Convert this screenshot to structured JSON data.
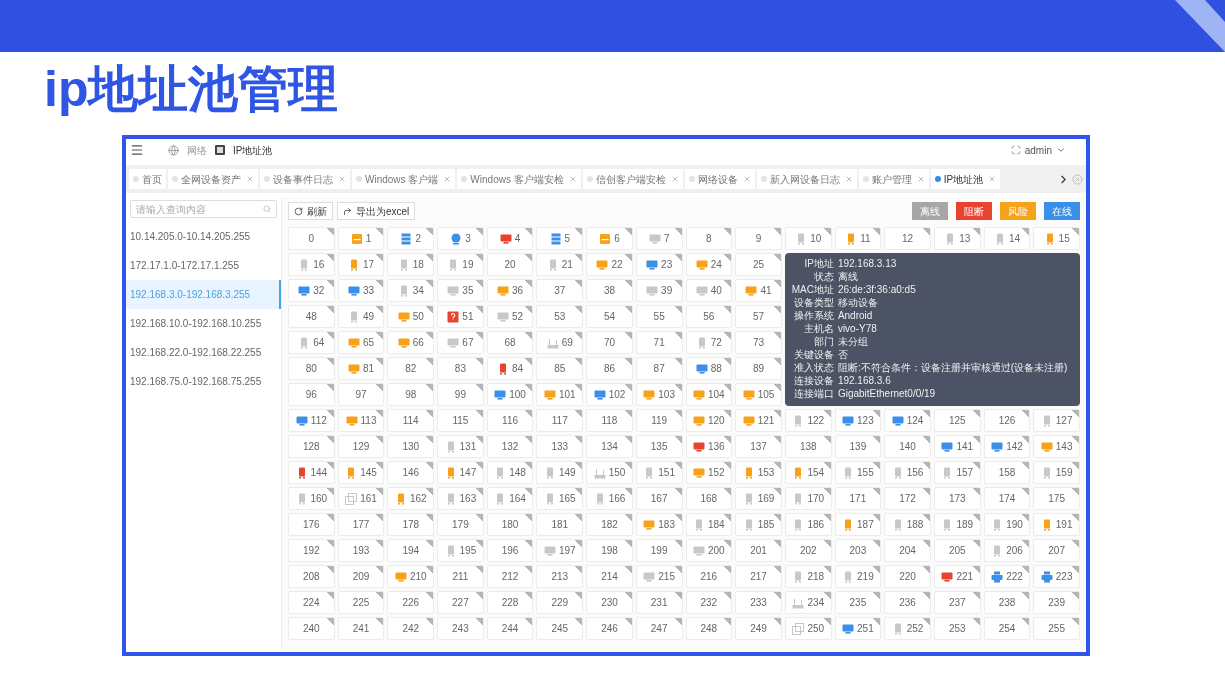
{
  "slide_title": "ip地址池管理",
  "header": {
    "breadcrumb": [
      "网络",
      "IP地址池"
    ],
    "user": "admin"
  },
  "tabs": [
    {
      "label": "首页",
      "selected": false,
      "closable": false
    },
    {
      "label": "全网设备资产",
      "selected": false,
      "closable": true
    },
    {
      "label": "设备事件日志",
      "selected": false,
      "closable": true
    },
    {
      "label": "Windows 客户端",
      "selected": false,
      "closable": true
    },
    {
      "label": "Windows 客户端安检",
      "selected": false,
      "closable": true
    },
    {
      "label": "信创客户端安检",
      "selected": false,
      "closable": true
    },
    {
      "label": "网络设备",
      "selected": false,
      "closable": true
    },
    {
      "label": "新入网设备日志",
      "selected": false,
      "closable": true
    },
    {
      "label": "账户管理",
      "selected": false,
      "closable": true
    },
    {
      "label": "IP地址池",
      "selected": true,
      "closable": true
    }
  ],
  "sidebar": {
    "search": {
      "placeholder": "请输入查询内容"
    },
    "items": [
      {
        "label": "10.14.205.0-10.14.205.255",
        "selected": false
      },
      {
        "label": "172.17.1.0-172.17.1.255",
        "selected": false
      },
      {
        "label": "192.168.3.0-192.168.3.255",
        "selected": true
      },
      {
        "label": "192.168.10.0-192.168.10.255",
        "selected": false
      },
      {
        "label": "192.168.22.0-192.168.22.255",
        "selected": false
      },
      {
        "label": "192.168.75.0-192.168.75.255",
        "selected": false
      }
    ]
  },
  "toolbar": {
    "buttons": [
      {
        "kind": "refresh",
        "label": "刷新"
      },
      {
        "kind": "export",
        "label": "导出为excel"
      }
    ],
    "legend": [
      {
        "label": "离线",
        "color": "#a6a6a6"
      },
      {
        "label": "阻断",
        "color": "#e8432f"
      },
      {
        "label": "风险",
        "color": "#f7a21b"
      },
      {
        "label": "在线",
        "color": "#3b8fe8"
      }
    ]
  },
  "grid": {
    "cells": [
      {
        "label": "0"
      },
      {
        "label": "1",
        "kind": "laptop",
        "color": "#f7a21b"
      },
      {
        "label": "2",
        "kind": "server",
        "color": "#3b8fe8"
      },
      {
        "label": "3",
        "kind": "camera",
        "color": "#3b8fe8"
      },
      {
        "label": "4",
        "kind": "monitor",
        "color": "#e8432f"
      },
      {
        "label": "5",
        "kind": "server",
        "color": "#3b8fe8"
      },
      {
        "label": "6",
        "kind": "laptop",
        "color": "#f7a21b"
      },
      {
        "label": "7",
        "kind": "monitor",
        "color": "#c8c8c8"
      },
      {
        "label": "8"
      },
      {
        "label": "9"
      },
      {
        "label": "10",
        "kind": "phone",
        "color": "#c8c8c8"
      },
      {
        "label": "11",
        "kind": "phone",
        "color": "#f7a21b"
      },
      {
        "label": "12"
      },
      {
        "label": "13",
        "kind": "phone",
        "color": "#c8c8c8"
      },
      {
        "label": "14",
        "kind": "phone",
        "color": "#c8c8c8"
      },
      {
        "label": "15",
        "kind": "phone",
        "color": "#f7a21b"
      },
      {
        "label": "16",
        "kind": "phone",
        "color": "#c8c8c8"
      },
      {
        "label": "17",
        "kind": "phone",
        "color": "#f7a21b"
      },
      {
        "label": "18",
        "kind": "phone",
        "color": "#c8c8c8"
      },
      {
        "label": "19",
        "kind": "phone",
        "color": "#c8c8c8"
      },
      {
        "label": "20"
      },
      {
        "label": "21",
        "kind": "phone",
        "color": "#c8c8c8"
      },
      {
        "label": "22",
        "kind": "monitor",
        "color": "#f7a21b"
      },
      {
        "label": "23",
        "kind": "monitor",
        "color": "#3b8fe8"
      },
      {
        "label": "24",
        "kind": "monitor",
        "color": "#f7a21b"
      },
      {
        "label": "25"
      },
      {
        "label": "32",
        "kind": "monitor",
        "color": "#3b8fe8"
      },
      {
        "label": "33",
        "kind": "monitor",
        "color": "#3b8fe8"
      },
      {
        "label": "34",
        "kind": "phone",
        "color": "#c8c8c8"
      },
      {
        "label": "35",
        "kind": "monitor",
        "color": "#c8c8c8"
      },
      {
        "label": "36",
        "kind": "monitor",
        "color": "#f7a21b"
      },
      {
        "label": "37"
      },
      {
        "label": "38"
      },
      {
        "label": "39",
        "kind": "monitor",
        "color": "#c8c8c8"
      },
      {
        "label": "40",
        "kind": "monitor",
        "color": "#c8c8c8"
      },
      {
        "label": "41",
        "kind": "monitor",
        "color": "#f7a21b"
      },
      {
        "label": "48"
      },
      {
        "label": "49",
        "kind": "phone",
        "color": "#c8c8c8"
      },
      {
        "label": "50",
        "kind": "monitor",
        "color": "#f7a21b"
      },
      {
        "label": "51",
        "kind": "question",
        "color": "#e8432f"
      },
      {
        "label": "52",
        "kind": "monitor",
        "color": "#c8c8c8"
      },
      {
        "label": "53"
      },
      {
        "label": "54"
      },
      {
        "label": "55"
      },
      {
        "label": "56"
      },
      {
        "label": "57"
      },
      {
        "label": "64",
        "kind": "phone",
        "color": "#c8c8c8"
      },
      {
        "label": "65",
        "kind": "monitor",
        "color": "#f7a21b"
      },
      {
        "label": "66",
        "kind": "monitor",
        "color": "#f7a21b"
      },
      {
        "label": "67",
        "kind": "monitor",
        "color": "#c8c8c8"
      },
      {
        "label": "68"
      },
      {
        "label": "69",
        "kind": "router",
        "color": "#c8c8c8"
      },
      {
        "label": "70"
      },
      {
        "label": "71"
      },
      {
        "label": "72",
        "kind": "phone",
        "color": "#c8c8c8"
      },
      {
        "label": "73"
      },
      {
        "label": "80"
      },
      {
        "label": "81",
        "kind": "monitor",
        "color": "#f7a21b"
      },
      {
        "label": "82"
      },
      {
        "label": "83"
      },
      {
        "label": "84",
        "kind": "phone",
        "color": "#e8432f"
      },
      {
        "label": "85"
      },
      {
        "label": "86"
      },
      {
        "label": "87"
      },
      {
        "label": "88",
        "kind": "monitor",
        "color": "#3b8fe8"
      },
      {
        "label": "89"
      },
      {
        "label": "96"
      },
      {
        "label": "97"
      },
      {
        "label": "98"
      },
      {
        "label": "99"
      },
      {
        "label": "100",
        "kind": "monitor",
        "color": "#3b8fe8"
      },
      {
        "label": "101",
        "kind": "monitor",
        "color": "#f7a21b"
      },
      {
        "label": "102",
        "kind": "monitor",
        "color": "#3b8fe8"
      },
      {
        "label": "103",
        "kind": "monitor",
        "color": "#f7a21b"
      },
      {
        "label": "104",
        "kind": "monitor",
        "color": "#f7a21b"
      },
      {
        "label": "105",
        "kind": "monitor",
        "color": "#f7a21b"
      },
      {
        "label": "112",
        "kind": "monitor",
        "color": "#3b8fe8"
      },
      {
        "label": "113",
        "kind": "monitor",
        "color": "#f7a21b"
      },
      {
        "label": "114"
      },
      {
        "label": "115"
      },
      {
        "label": "116"
      },
      {
        "label": "117"
      },
      {
        "label": "118"
      },
      {
        "label": "119"
      },
      {
        "label": "120",
        "kind": "monitor",
        "color": "#f7a21b"
      },
      {
        "label": "121",
        "kind": "monitor",
        "color": "#f7a21b"
      },
      {
        "label": "122",
        "kind": "phone",
        "color": "#c8c8c8"
      },
      {
        "label": "123",
        "kind": "monitor",
        "color": "#3b8fe8"
      },
      {
        "label": "124",
        "kind": "monitor",
        "color": "#3b8fe8"
      },
      {
        "label": "125"
      },
      {
        "label": "126"
      },
      {
        "label": "127",
        "kind": "phone",
        "color": "#c8c8c8"
      },
      {
        "label": "128"
      },
      {
        "label": "129"
      },
      {
        "label": "130"
      },
      {
        "label": "131",
        "kind": "phone",
        "color": "#c8c8c8"
      },
      {
        "label": "132"
      },
      {
        "label": "133"
      },
      {
        "label": "134"
      },
      {
        "label": "135"
      },
      {
        "label": "136",
        "kind": "monitor",
        "color": "#e8432f"
      },
      {
        "label": "137"
      },
      {
        "label": "138"
      },
      {
        "label": "139"
      },
      {
        "label": "140"
      },
      {
        "label": "141",
        "kind": "monitor",
        "color": "#3b8fe8"
      },
      {
        "label": "142",
        "kind": "monitor",
        "color": "#3b8fe8"
      },
      {
        "label": "143",
        "kind": "monitor",
        "color": "#f7a21b"
      },
      {
        "label": "144",
        "kind": "phone",
        "color": "#e8432f"
      },
      {
        "label": "145",
        "kind": "phone",
        "color": "#f7a21b"
      },
      {
        "label": "146"
      },
      {
        "label": "147",
        "kind": "phone",
        "color": "#f7a21b"
      },
      {
        "label": "148",
        "kind": "phone",
        "color": "#c8c8c8"
      },
      {
        "label": "149",
        "kind": "phone",
        "color": "#c8c8c8"
      },
      {
        "label": "150",
        "kind": "router",
        "color": "#c8c8c8"
      },
      {
        "label": "151",
        "kind": "phone",
        "color": "#c8c8c8"
      },
      {
        "label": "152",
        "kind": "monitor",
        "color": "#f7a21b"
      },
      {
        "label": "153",
        "kind": "phone",
        "color": "#f7a21b"
      },
      {
        "label": "154",
        "kind": "phone",
        "color": "#f7a21b"
      },
      {
        "label": "155",
        "kind": "phone",
        "color": "#c8c8c8"
      },
      {
        "label": "156",
        "kind": "phone",
        "color": "#c8c8c8"
      },
      {
        "label": "157",
        "kind": "phone",
        "color": "#c8c8c8"
      },
      {
        "label": "158"
      },
      {
        "label": "159",
        "kind": "phone",
        "color": "#c8c8c8"
      },
      {
        "label": "160",
        "kind": "phone",
        "color": "#c8c8c8"
      },
      {
        "label": "161",
        "kind": "stack",
        "color": "#c8c8c8"
      },
      {
        "label": "162",
        "kind": "phone",
        "color": "#f7a21b"
      },
      {
        "label": "163",
        "kind": "phone",
        "color": "#c8c8c8"
      },
      {
        "label": "164",
        "kind": "phone",
        "color": "#c8c8c8"
      },
      {
        "label": "165",
        "kind": "phone",
        "color": "#c8c8c8"
      },
      {
        "label": "166",
        "kind": "phone",
        "color": "#c8c8c8"
      },
      {
        "label": "167"
      },
      {
        "label": "168"
      },
      {
        "label": "169",
        "kind": "phone",
        "color": "#c8c8c8"
      },
      {
        "label": "170",
        "kind": "phone",
        "color": "#c8c8c8"
      },
      {
        "label": "171"
      },
      {
        "label": "172"
      },
      {
        "label": "173"
      },
      {
        "label": "174"
      },
      {
        "label": "175"
      },
      {
        "label": "176"
      },
      {
        "label": "177"
      },
      {
        "label": "178"
      },
      {
        "label": "179"
      },
      {
        "label": "180"
      },
      {
        "label": "181"
      },
      {
        "label": "182"
      },
      {
        "label": "183",
        "kind": "monitor",
        "color": "#f7a21b"
      },
      {
        "label": "184",
        "kind": "phone",
        "color": "#c8c8c8"
      },
      {
        "label": "185",
        "kind": "phone",
        "color": "#c8c8c8"
      },
      {
        "label": "186",
        "kind": "phone",
        "color": "#c8c8c8"
      },
      {
        "label": "187",
        "kind": "phone",
        "color": "#f7a21b"
      },
      {
        "label": "188",
        "kind": "phone",
        "color": "#c8c8c8"
      },
      {
        "label": "189",
        "kind": "phone",
        "color": "#c8c8c8"
      },
      {
        "label": "190",
        "kind": "phone",
        "color": "#c8c8c8"
      },
      {
        "label": "191",
        "kind": "phone",
        "color": "#f7a21b"
      },
      {
        "label": "192"
      },
      {
        "label": "193"
      },
      {
        "label": "194"
      },
      {
        "label": "195",
        "kind": "phone",
        "color": "#c8c8c8"
      },
      {
        "label": "196"
      },
      {
        "label": "197",
        "kind": "monitor",
        "color": "#c8c8c8"
      },
      {
        "label": "198"
      },
      {
        "label": "199"
      },
      {
        "label": "200",
        "kind": "monitor",
        "color": "#c8c8c8"
      },
      {
        "label": "201"
      },
      {
        "label": "202"
      },
      {
        "label": "203"
      },
      {
        "label": "204"
      },
      {
        "label": "205"
      },
      {
        "label": "206",
        "kind": "phone",
        "color": "#c8c8c8"
      },
      {
        "label": "207"
      },
      {
        "label": "208"
      },
      {
        "label": "209"
      },
      {
        "label": "210",
        "kind": "monitor",
        "color": "#f7a21b"
      },
      {
        "label": "211"
      },
      {
        "label": "212"
      },
      {
        "label": "213"
      },
      {
        "label": "214"
      },
      {
        "label": "215",
        "kind": "monitor",
        "color": "#c8c8c8"
      },
      {
        "label": "216"
      },
      {
        "label": "217"
      },
      {
        "label": "218",
        "kind": "phone",
        "color": "#c8c8c8"
      },
      {
        "label": "219",
        "kind": "phone",
        "color": "#c8c8c8"
      },
      {
        "label": "220"
      },
      {
        "label": "221",
        "kind": "monitor",
        "color": "#e8432f"
      },
      {
        "label": "222",
        "kind": "printer",
        "color": "#3b8fe8"
      },
      {
        "label": "223",
        "kind": "printer",
        "color": "#3b8fe8"
      },
      {
        "label": "224"
      },
      {
        "label": "225"
      },
      {
        "label": "226"
      },
      {
        "label": "227"
      },
      {
        "label": "228"
      },
      {
        "label": "229"
      },
      {
        "label": "230"
      },
      {
        "label": "231"
      },
      {
        "label": "232"
      },
      {
        "label": "233"
      },
      {
        "label": "234",
        "kind": "router",
        "color": "#c8c8c8"
      },
      {
        "label": "235"
      },
      {
        "label": "236"
      },
      {
        "label": "237"
      },
      {
        "label": "238"
      },
      {
        "label": "239"
      },
      {
        "label": "240"
      },
      {
        "label": "241"
      },
      {
        "label": "242"
      },
      {
        "label": "243"
      },
      {
        "label": "244"
      },
      {
        "label": "245"
      },
      {
        "label": "246"
      },
      {
        "label": "247"
      },
      {
        "label": "248"
      },
      {
        "label": "249"
      },
      {
        "label": "250",
        "kind": "stack",
        "color": "#c8c8c8"
      },
      {
        "label": "251",
        "kind": "monitor",
        "color": "#3b8fe8"
      },
      {
        "label": "252",
        "kind": "phone",
        "color": "#c8c8c8"
      },
      {
        "label": "253"
      },
      {
        "label": "254"
      },
      {
        "label": "255"
      }
    ]
  },
  "tooltip": [
    {
      "label": "IP地址",
      "value": "192.168.3.13"
    },
    {
      "label": "状态",
      "value": "离线"
    },
    {
      "label": "MAC地址",
      "value": "26:de:3f:36:a0:d5"
    },
    {
      "label": "设备类型",
      "value": "移动设备"
    },
    {
      "label": "操作系统",
      "value": "Android"
    },
    {
      "label": "主机名",
      "value": "vivo-Y78"
    },
    {
      "label": "部门",
      "value": "未分组"
    },
    {
      "label": "关键设备",
      "value": "否"
    },
    {
      "label": "准入状态",
      "value": "阻断:不符合条件：设备注册并审核通过(设备未注册)"
    },
    {
      "label": "连接设备",
      "value": "192.168.3.6"
    },
    {
      "label": "连接端口",
      "value": "GigabitEthernet0/0/19"
    }
  ]
}
